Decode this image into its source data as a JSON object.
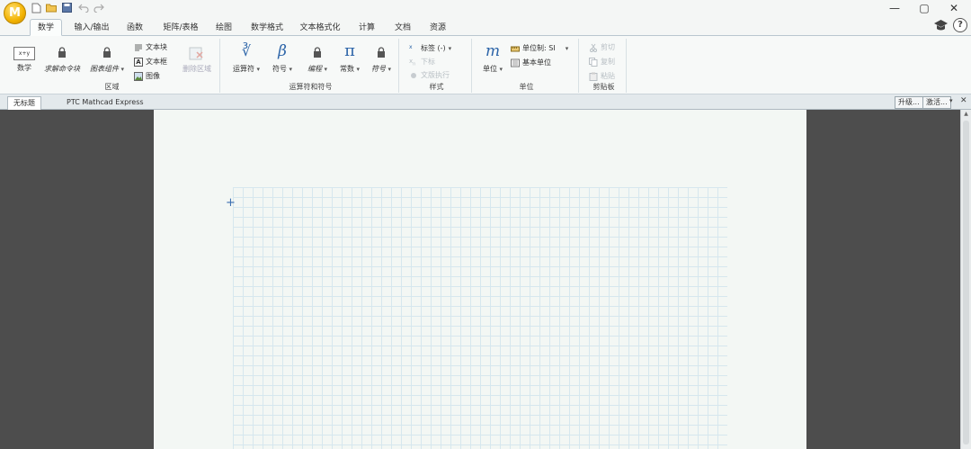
{
  "titlebar": {
    "logo_letter": "M",
    "window_controls": {
      "minimize": "—",
      "restore": "▢",
      "close": "✕"
    }
  },
  "tabs": [
    {
      "label": "数学",
      "active": true
    },
    {
      "label": "输入/输出"
    },
    {
      "label": "函数"
    },
    {
      "label": "矩阵/表格"
    },
    {
      "label": "绘图"
    },
    {
      "label": "数学格式"
    },
    {
      "label": "文本格式化"
    },
    {
      "label": "计算"
    },
    {
      "label": "文档"
    },
    {
      "label": "资源"
    }
  ],
  "ribbon": {
    "region": {
      "label": "区域",
      "math": "数学",
      "math_icon_text": "x+y",
      "solve_block": "求解命令块",
      "chart_component": "图表组件",
      "text_block": "文本块",
      "text_box": "文本框",
      "image": "图像",
      "delete_region": "删除区域"
    },
    "operators": {
      "label": "运算符和符号",
      "operator": "运算符",
      "operator_icon": "∛",
      "symbol": "符号",
      "symbol_icon": "β",
      "programming": "编程",
      "constant": "常数",
      "constant_icon": "π",
      "symbols2": "符号"
    },
    "style": {
      "label": "样式",
      "label_dropdown": "标签 (-)",
      "subscript": "下标",
      "wrap": "文版执行"
    },
    "units": {
      "label": "单位",
      "unit": "单位",
      "unit_icon": "m",
      "unit_system": "单位制: SI",
      "base_units": "基本单位"
    },
    "clipboard": {
      "label": "剪贴板",
      "cut": "剪切",
      "copy": "复制",
      "paste": "粘贴"
    }
  },
  "docbar": {
    "doc_tab": "无标题",
    "app_name": "PTC Mathcad Express",
    "upgrade": "升级...",
    "activate": "激活..."
  },
  "colors": {
    "accent": "#3b6fb0",
    "page": "#f3f7f4",
    "grid_line": "#d6e7ee",
    "workspace": "#4d4d4d"
  }
}
